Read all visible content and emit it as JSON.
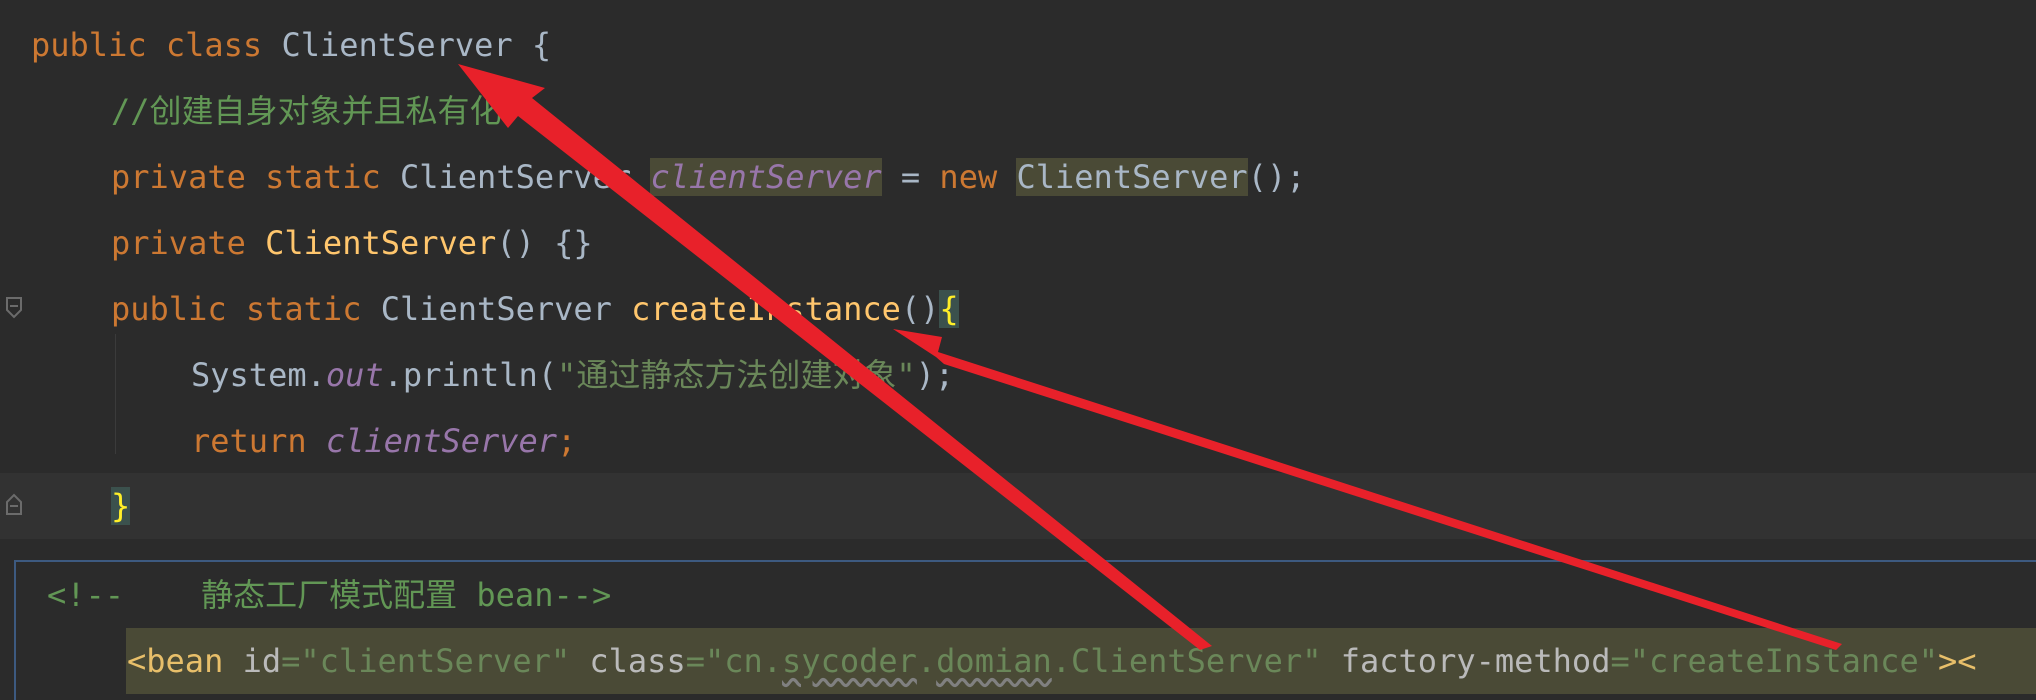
{
  "java": {
    "line1": {
      "kw1": "public",
      "kw2": "class",
      "name": "ClientServer",
      "brace": "{"
    },
    "line2": {
      "comment": "//创建自身对象并且私有化"
    },
    "line3": {
      "kw1": "private",
      "kw2": "static",
      "type": "ClientServer",
      "field": "clientServer",
      "eq": "=",
      "kwnew": "new",
      "ctor": "ClientServer",
      "tail": "();"
    },
    "line4": {
      "kw1": "private",
      "ctor": "ClientServer",
      "tail": "() {}"
    },
    "line5": {
      "kw1": "public",
      "kw2": "static",
      "type": "ClientServer",
      "method": "createInstance",
      "parens": "()",
      "brace": "{"
    },
    "line6": {
      "sys": "System.",
      "out": "out",
      "call": ".println(",
      "str": "\"通过静态方法创建对象\"",
      "end": ");"
    },
    "line7": {
      "kw": "return",
      "field": "clientServer",
      "semi": ";"
    },
    "line8": {
      "brace": "}"
    }
  },
  "xml": {
    "comment_open": "<!--",
    "comment_text": "静态工厂模式配置 bean",
    "comment_close": "-->",
    "tag_open": "<bean",
    "attr_id": "id",
    "val_id": "\"clientServer\"",
    "attr_class": "class",
    "val_class_q": "\"",
    "val_class_cn": "cn.",
    "val_class_sycoder": "sycoder",
    "val_class_dot": ".",
    "val_class_domian": "domian",
    "val_class_rest": ".ClientServer\"",
    "attr_factory": "factory-method",
    "val_factory": "\"createInstance\"",
    "tag_close": "><"
  },
  "colors": {
    "arrow": "#e8212a",
    "keyword": "#cc7832",
    "function": "#ffc66d",
    "string": "#6a8759",
    "comment": "#629755",
    "static_field": "#9876aa"
  }
}
